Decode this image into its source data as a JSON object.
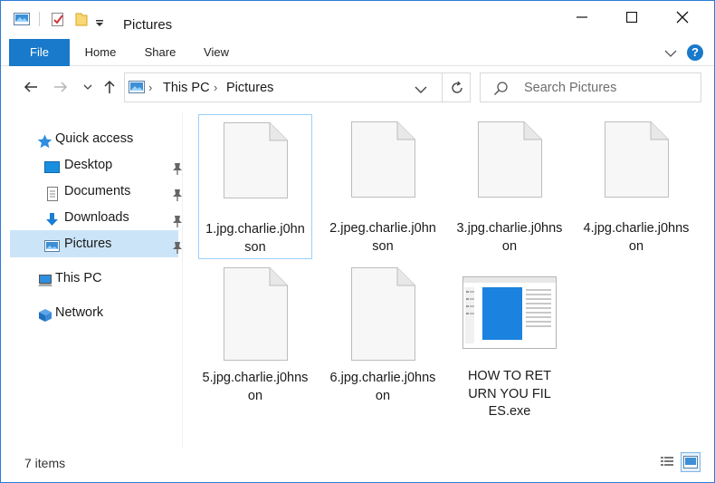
{
  "window": {
    "title": "Pictures",
    "accent": "#1979ca"
  },
  "ribbon": {
    "tabs": [
      "File",
      "Home",
      "Share",
      "View"
    ],
    "help": "?"
  },
  "address": {
    "crumbs": [
      "This PC",
      "Pictures"
    ]
  },
  "search": {
    "placeholder": "Search Pictures"
  },
  "nav": {
    "quick_access": "Quick access",
    "items": [
      {
        "label": "Desktop",
        "icon": "desktop-icon",
        "pinned": true
      },
      {
        "label": "Documents",
        "icon": "documents-icon",
        "pinned": true
      },
      {
        "label": "Downloads",
        "icon": "downloads-icon",
        "pinned": true
      },
      {
        "label": "Pictures",
        "icon": "pictures-icon",
        "pinned": true,
        "selected": true
      }
    ],
    "this_pc": "This PC",
    "network": "Network"
  },
  "files": [
    {
      "name": "1.jpg.charlie.j0hnson",
      "type": "document"
    },
    {
      "name": "2.jpeg.charlie.j0hnson",
      "type": "document"
    },
    {
      "name": "3.jpg.charlie.j0hnson",
      "type": "document"
    },
    {
      "name": "4.jpg.charlie.j0hnson",
      "type": "document"
    },
    {
      "name": "5.jpg.charlie.j0hnson",
      "type": "document"
    },
    {
      "name": "6.jpg.charlie.j0hnson",
      "type": "document"
    },
    {
      "name": "HOW TO RETURN YOU FILES.exe",
      "type": "executable"
    }
  ],
  "status": {
    "count": "7 items"
  }
}
